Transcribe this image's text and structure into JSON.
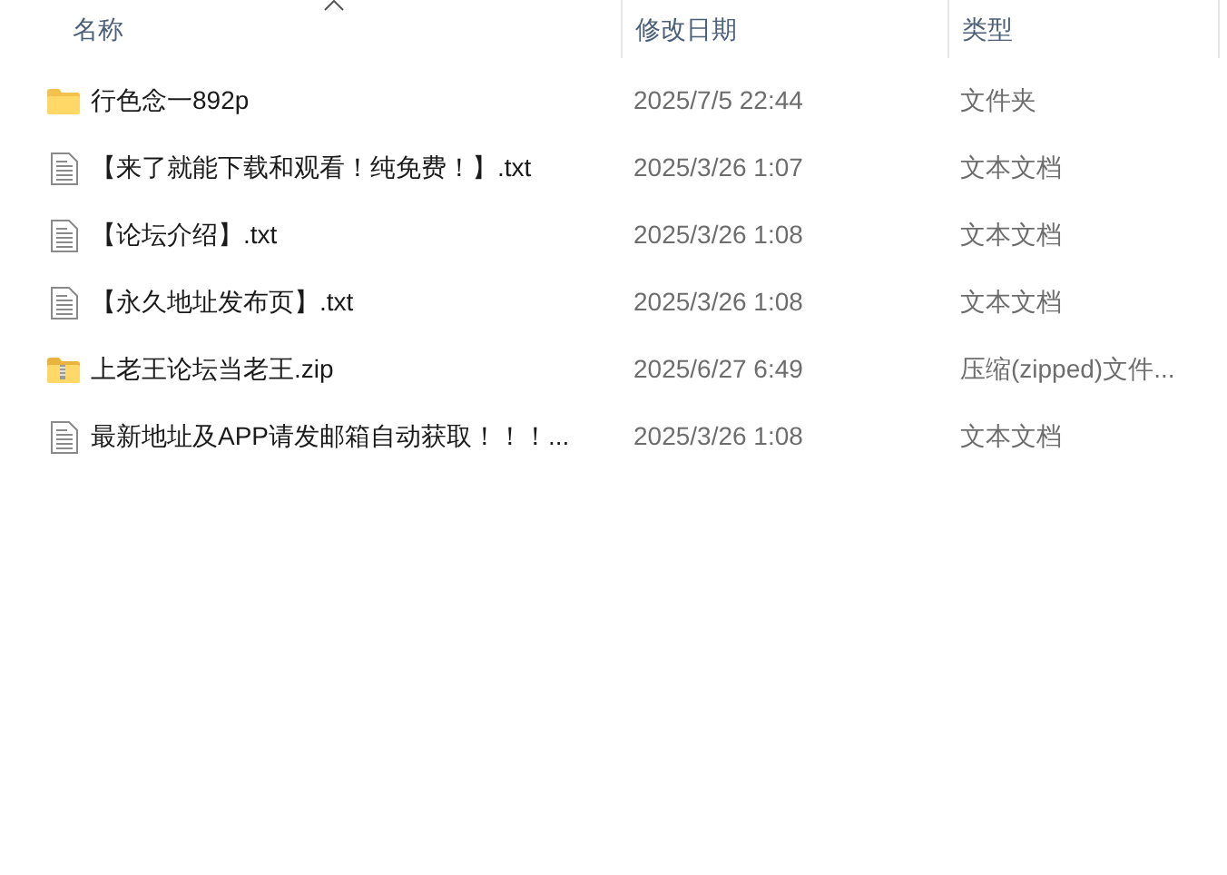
{
  "columns": [
    {
      "label": "名称",
      "sorted": true
    },
    {
      "label": "修改日期",
      "sorted": false
    },
    {
      "label": "类型",
      "sorted": false
    }
  ],
  "files": [
    {
      "kind": "folder",
      "name": "行色念一892p",
      "date": "2025/7/5 22:44",
      "type": "文件夹"
    },
    {
      "kind": "text",
      "name": "【来了就能下载和观看！纯免费！】.txt",
      "date": "2025/3/26 1:07",
      "type": "文本文档"
    },
    {
      "kind": "text",
      "name": "【论坛介绍】.txt",
      "date": "2025/3/26 1:08",
      "type": "文本文档"
    },
    {
      "kind": "text",
      "name": "【永久地址发布页】.txt",
      "date": "2025/3/26 1:08",
      "type": "文本文档"
    },
    {
      "kind": "zip",
      "name": "上老王论坛当老王.zip",
      "date": "2025/6/27 6:49",
      "type": "压缩(zipped)文件..."
    },
    {
      "kind": "text",
      "name": "最新地址及APP请发邮箱自动获取！！！...",
      "date": "2025/3/26 1:08",
      "type": "文本文档"
    }
  ]
}
